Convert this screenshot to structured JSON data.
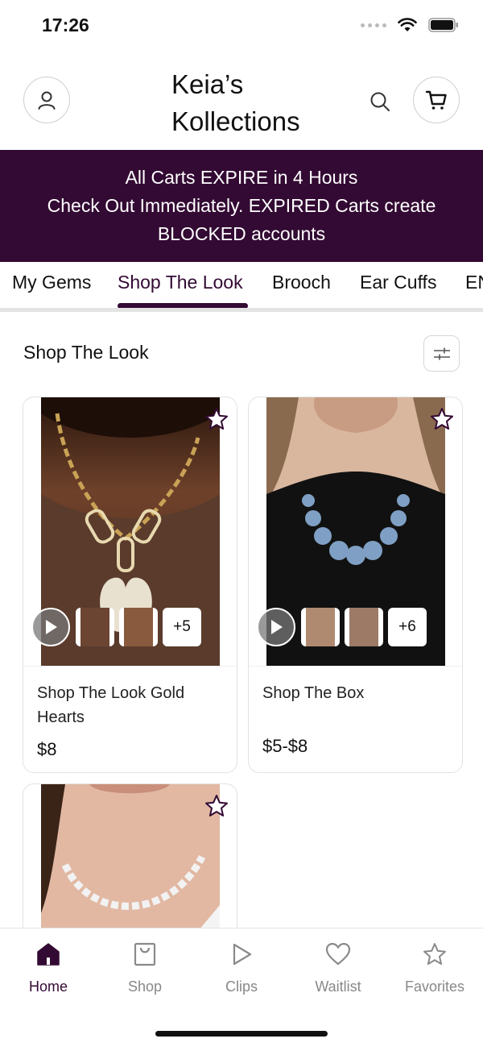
{
  "status_bar": {
    "time": "17:26"
  },
  "header": {
    "store_name": "Keia’s Kollections"
  },
  "banner": {
    "line1": "All Carts EXPIRE in 4 Hours",
    "line2": "Check Out Immediately. EXPIRED Carts create",
    "line3": "BLOCKED accounts"
  },
  "tabs": [
    {
      "label": "My Gems",
      "active": false
    },
    {
      "label": "Shop The Look",
      "active": true
    },
    {
      "label": "Brooch",
      "active": false
    },
    {
      "label": "Ear Cuffs",
      "active": false
    },
    {
      "label": "EN",
      "active": false
    }
  ],
  "section": {
    "title": "Shop The Look"
  },
  "products": [
    {
      "title": "Shop The Look Gold Hearts",
      "price": "$8",
      "more_count": "+5"
    },
    {
      "title": "Shop The Box",
      "price": "$5-$8",
      "more_count": "+6"
    },
    {
      "title": "",
      "price": "",
      "more_count": ""
    }
  ],
  "bottom_nav": [
    {
      "label": "Home",
      "icon": "home-icon",
      "active": true
    },
    {
      "label": "Shop",
      "icon": "shopping-bag-icon",
      "active": false
    },
    {
      "label": "Clips",
      "icon": "play-icon",
      "active": false
    },
    {
      "label": "Waitlist",
      "icon": "heart-icon",
      "active": false
    },
    {
      "label": "Favorites",
      "icon": "star-icon",
      "active": false
    }
  ],
  "colors": {
    "brand": "#330a33",
    "inactive": "#888888"
  }
}
